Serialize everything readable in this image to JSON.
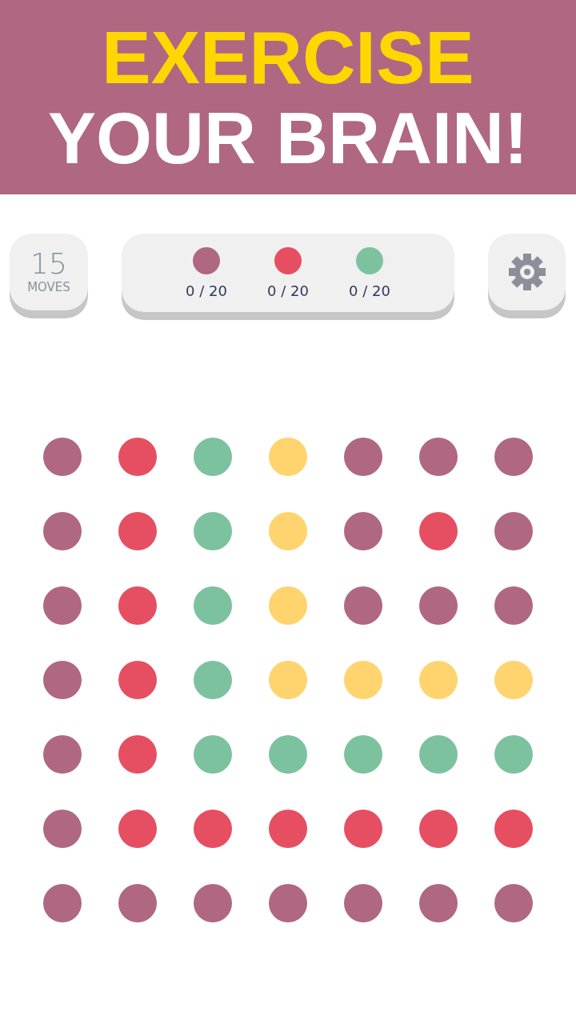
{
  "banner": {
    "line_1": "EXERCISE",
    "line_2": "YOUR BRAIN!"
  },
  "moves": {
    "count": "15",
    "label": "MOVES"
  },
  "goals": [
    {
      "color": "#b06781",
      "progress": "0 / 20"
    },
    {
      "color": "#e64f61",
      "progress": "0 / 20"
    },
    {
      "color": "#7cc29f",
      "progress": "0 / 20"
    }
  ],
  "board": {
    "rows": [
      {
        "dots": [
          {
            "color": "#b06781"
          },
          {
            "color": "#e64f61"
          },
          {
            "color": "#7cc29f"
          },
          {
            "color": "#ffd46e"
          },
          {
            "color": "#b06781"
          },
          {
            "color": "#b06781"
          },
          {
            "color": "#b06781"
          }
        ]
      },
      {
        "dots": [
          {
            "color": "#b06781"
          },
          {
            "color": "#e64f61"
          },
          {
            "color": "#7cc29f"
          },
          {
            "color": "#ffd46e"
          },
          {
            "color": "#b06781"
          },
          {
            "color": "#e64f61"
          },
          {
            "color": "#b06781"
          }
        ]
      },
      {
        "dots": [
          {
            "color": "#b06781"
          },
          {
            "color": "#e64f61"
          },
          {
            "color": "#7cc29f"
          },
          {
            "color": "#ffd46e"
          },
          {
            "color": "#b06781"
          },
          {
            "color": "#b06781"
          },
          {
            "color": "#b06781"
          }
        ]
      },
      {
        "dots": [
          {
            "color": "#b06781"
          },
          {
            "color": "#e64f61"
          },
          {
            "color": "#7cc29f"
          },
          {
            "color": "#ffd46e"
          },
          {
            "color": "#ffd46e"
          },
          {
            "color": "#ffd46e"
          },
          {
            "color": "#ffd46e"
          }
        ]
      },
      {
        "dots": [
          {
            "color": "#b06781"
          },
          {
            "color": "#e64f61"
          },
          {
            "color": "#7cc29f"
          },
          {
            "color": "#7cc29f"
          },
          {
            "color": "#7cc29f"
          },
          {
            "color": "#7cc29f"
          },
          {
            "color": "#7cc29f"
          }
        ]
      },
      {
        "dots": [
          {
            "color": "#b06781"
          },
          {
            "color": "#e64f61"
          },
          {
            "color": "#e64f61"
          },
          {
            "color": "#e64f61"
          },
          {
            "color": "#e64f61"
          },
          {
            "color": "#e64f61"
          },
          {
            "color": "#e64f61"
          }
        ]
      },
      {
        "dots": [
          {
            "color": "#b06781"
          },
          {
            "color": "#b06781"
          },
          {
            "color": "#b06781"
          },
          {
            "color": "#b06781"
          },
          {
            "color": "#b06781"
          },
          {
            "color": "#b06781"
          },
          {
            "color": "#b06781"
          }
        ]
      }
    ]
  }
}
